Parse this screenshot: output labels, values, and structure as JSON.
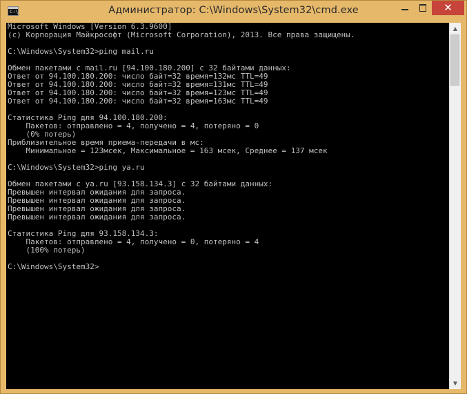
{
  "window": {
    "title": "Администратор: C:\\Windows\\System32\\cmd.exe",
    "icon": "cmd-icon",
    "icon_glyph": "C:\\",
    "controls": {
      "minimize_icon": "minimize-icon",
      "maximize_icon": "maximize-icon",
      "close_label": "✕"
    }
  },
  "console": {
    "lines": [
      "Microsoft Windows [Version 6.3.9600]",
      "(c) Корпорация Майкрософт (Microsoft Corporation), 2013. Все права защищены.",
      "",
      "C:\\Windows\\System32>ping mail.ru",
      "",
      "Обмен пакетами с mail.ru [94.100.180.200] с 32 байтами данных:",
      "Ответ от 94.100.180.200: число байт=32 время=132мс TTL=49",
      "Ответ от 94.100.180.200: число байт=32 время=131мс TTL=49",
      "Ответ от 94.100.180.200: число байт=32 время=123мс TTL=49",
      "Ответ от 94.100.180.200: число байт=32 время=163мс TTL=49",
      "",
      "Статистика Ping для 94.100.180.200:",
      "    Пакетов: отправлено = 4, получено = 4, потеряно = 0",
      "    (0% потерь)",
      "Приблизительное время приема-передачи в мс:",
      "    Минимальное = 123мсек, Максимальное = 163 мсек, Среднее = 137 мсек",
      "",
      "C:\\Windows\\System32>ping ya.ru",
      "",
      "Обмен пакетами с ya.ru [93.158.134.3] с 32 байтами данных:",
      "Превышен интервал ожидания для запроса.",
      "Превышен интервал ожидания для запроса.",
      "Превышен интервал ожидания для запроса.",
      "Превышен интервал ожидания для запроса.",
      "",
      "Статистика Ping для 93.158.134.3:",
      "    Пакетов: отправлено = 4, получено = 0, потеряно = 4",
      "    (100% потерь)",
      "",
      "C:\\Windows\\System32>"
    ]
  },
  "scrollbar": {
    "up_arrow": "▲",
    "down_arrow": "▼"
  },
  "colors": {
    "frame": "#e6b86a",
    "console_bg": "#000000",
    "console_fg": "#c0c0c0",
    "close_button": "#c7443a"
  }
}
